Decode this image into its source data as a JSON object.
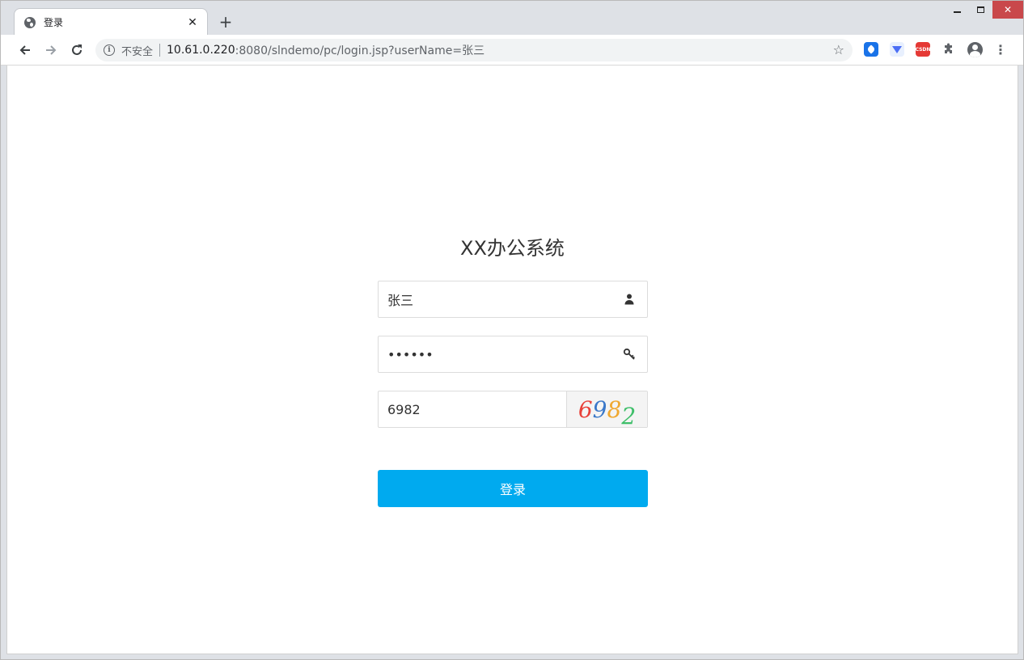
{
  "browser": {
    "tab_title": "登录",
    "new_tab_symbol": "+",
    "close_symbol": "✕",
    "insecure_label": "不安全",
    "url_host": "10.61.0.220",
    "url_rest": ":8080/slndemo/pc/login.jsp?userName=张三",
    "ext_csdn_label": "CSDN"
  },
  "login": {
    "title": "XX办公系统",
    "username_value": "张三",
    "password_value": "••••••",
    "captcha_input_value": "6982",
    "captcha_digits": [
      "6",
      "9",
      "8",
      "2"
    ],
    "submit_label": "登录"
  },
  "colors": {
    "button_bg": "#00aaef",
    "close_btn": "#c9484b"
  }
}
